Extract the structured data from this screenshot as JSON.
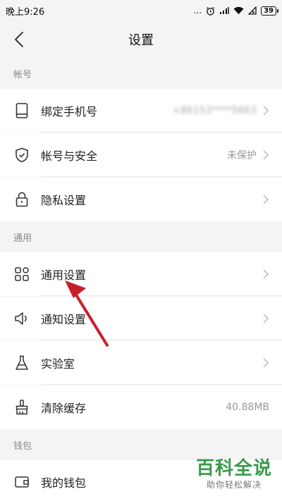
{
  "status_bar": {
    "time": "晚上9:26",
    "signal_dots": "...",
    "battery": "39"
  },
  "header": {
    "title": "设置"
  },
  "sections": [
    {
      "title": "帐号",
      "items": [
        {
          "label": "绑定手机号",
          "value": "+86153****5663",
          "icon": "phone-icon"
        },
        {
          "label": "帐号与安全",
          "value": "未保护",
          "icon": "shield-icon"
        },
        {
          "label": "隐私设置",
          "value": "",
          "icon": "lock-icon"
        }
      ]
    },
    {
      "title": "通用",
      "items": [
        {
          "label": "通用设置",
          "value": "",
          "icon": "grid-icon"
        },
        {
          "label": "通知设置",
          "value": "",
          "icon": "speaker-icon"
        },
        {
          "label": "实验室",
          "value": "",
          "icon": "flask-icon"
        },
        {
          "label": "清除缓存",
          "value": "40.88MB",
          "icon": "broom-icon"
        }
      ]
    },
    {
      "title": "钱包",
      "items": [
        {
          "label": "我的钱包",
          "value": "",
          "icon": "wallet-icon"
        }
      ]
    }
  ],
  "colors": {
    "annotation_arrow": "#c8202b",
    "watermark": "#3a9a4a"
  },
  "watermark": {
    "title": "百科全说",
    "subtitle": "助你轻松解决"
  }
}
